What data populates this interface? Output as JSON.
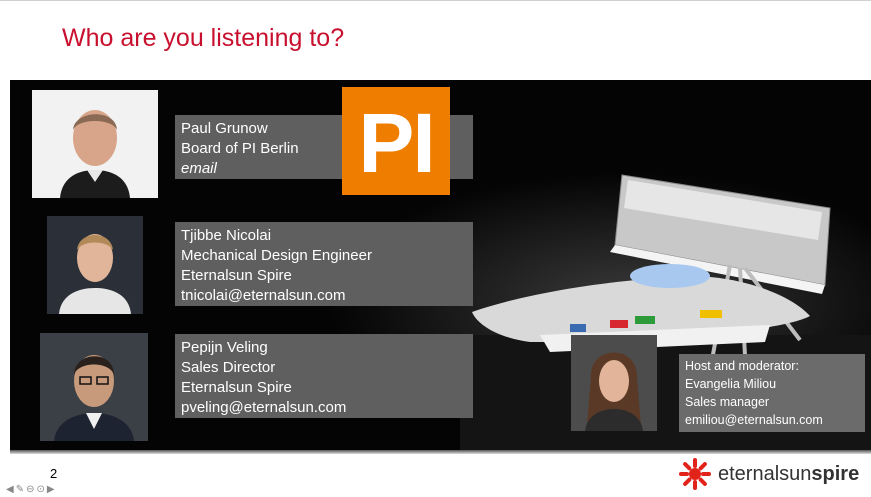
{
  "slide": {
    "title": "Who are you listening to?",
    "page_number": "2"
  },
  "speakers": [
    {
      "lines": [
        "Paul Grunow",
        "Board of PI Berlin",
        "email"
      ]
    },
    {
      "lines": [
        "Tjibbe Nicolai",
        "Mechanical Design Engineer",
        "Eternalsun Spire",
        "tnicolai@eternalsun.com"
      ]
    },
    {
      "lines": [
        "Pepijn Veling",
        "Sales Director",
        "Eternalsun Spire",
        "pveling@eternalsun.com"
      ]
    }
  ],
  "host": {
    "lines": [
      "Host and moderator:",
      "Evangelia Miliou",
      "Sales manager",
      "emiliou@eternalsun.com"
    ]
  },
  "logo": {
    "text": "PI"
  },
  "brand": {
    "part1": "eternalsun",
    "part2": "spire"
  },
  "colors": {
    "title": "#c8102e",
    "pi_orange": "#ef7d00",
    "brand_red": "#e2231a",
    "box_gray": "#5f5f5f"
  }
}
